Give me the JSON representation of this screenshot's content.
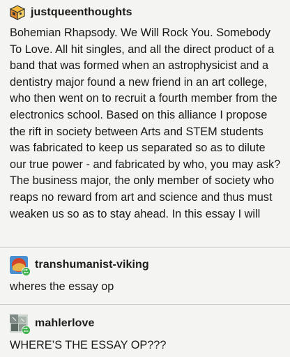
{
  "post": {
    "username": "justqueenthoughts",
    "avatar_icon": "game-cube-icon",
    "body": "Bohemian Rhapsody. We Will Rock You. Somebody To Love. All hit singles, and all the direct product of a band that was formed when an astrophysicist and a dentistry major found a new friend in an art college, who then went on to recruit a fourth member from the electronics school. Based on this alliance I propose the rift in society between Arts and STEM students was fabricated to keep us separated so as to dilute our true power - and fabricated by who, you may ask? The business major, the only member of society who reaps no reward from art and science and thus must weaken us so as to stay ahead. In this essay I will"
  },
  "replies": [
    {
      "username": "transhumanist-viking",
      "avatar_icon": "red-planet-avatar-icon",
      "badge_icon": "reblog-badge-icon",
      "text": "wheres the essay op"
    },
    {
      "username": "mahlerlove",
      "avatar_icon": "collage-avatar-icon",
      "badge_icon": "reblog-badge-icon",
      "text": "WHERE’S THE ESSAY OP???"
    }
  ],
  "colors": {
    "background": "#f4f4f2",
    "text": "#181818",
    "divider": "#c9c9c7",
    "badge": "#3bb14a"
  }
}
